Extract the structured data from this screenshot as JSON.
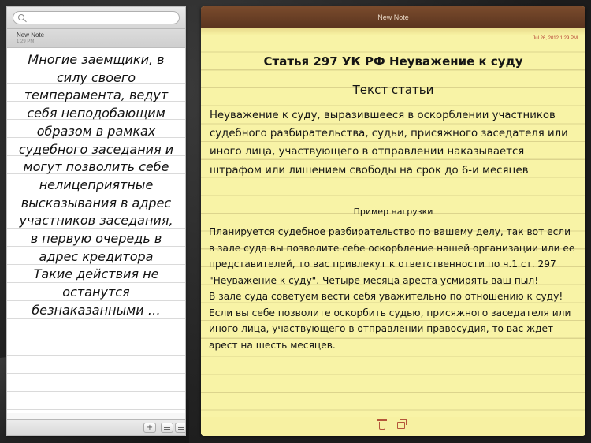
{
  "search": {
    "placeholder": ""
  },
  "list": {
    "selected_item": {
      "title": "New Note",
      "time": "1:29 PM"
    },
    "overlay_text": "Многие заемщики, в силу своего темперамента, ведут себя неподобающим образом в рамках судебного заседания и могут позволить себе нелицеприятные высказывания в адрес участников заседания, в первую очередь в адрес кредитора\nТакие действия не останутся безнаказанными …"
  },
  "footer": {
    "add_label": "+"
  },
  "note": {
    "title": "New Note",
    "date": "Jul 26, 2012 1:29 PM",
    "heading": "Статья 297 УК РФ Неуважение к суду",
    "subheading": "Текст статьи",
    "body": "Неуважение к суду, выразившееся в оскорблении участников судебного разбирательства, судьи, присяжного заседателя или иного лица, участвующего в отправлении наказывается штрафом или лишением свободы на срок до 6-и месяцев",
    "example_title": "Пример нагрузки",
    "example_text": "Планируется судебное разбирательство по вашему делу, так вот если в зале суда вы позволите себе оскорбление нашей организации или ее представителей, то вас привлекут к ответственности по ч.1 ст. 297 \"Неуважение к суду\". Четыре месяца ареста усмирять ваш пыл!\nВ зале суда советуем вести себя уважительно по отношению к суду!\nЕсли вы себе позволите оскорбить судью, присяжного заседателя или иного лица, участвующего в отправлении правосудия, то вас ждет арест на шесть месяцев."
  }
}
